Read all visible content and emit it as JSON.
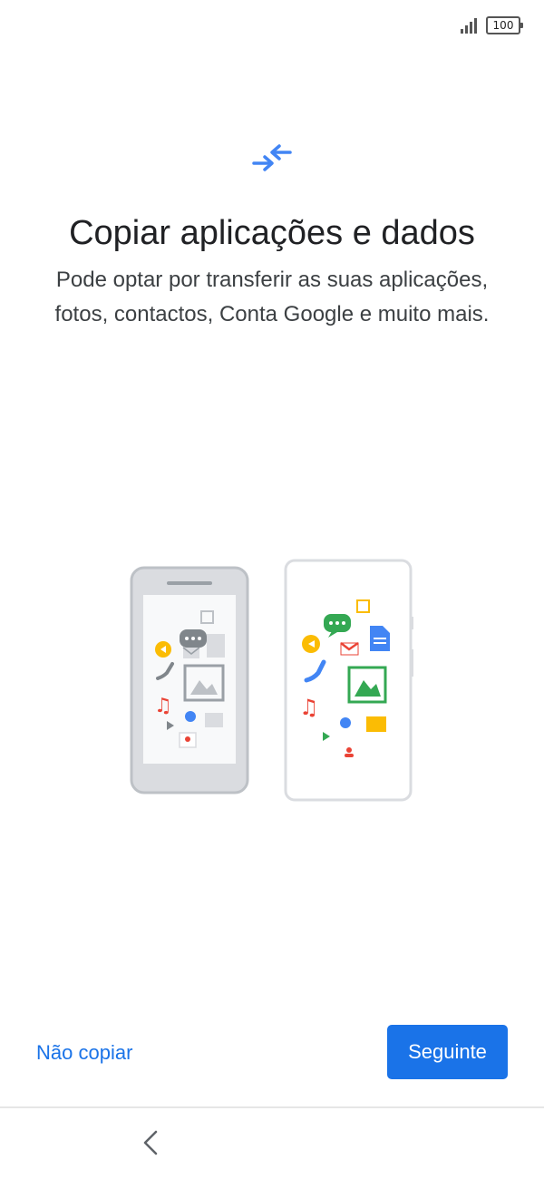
{
  "status_bar": {
    "battery_level": "100",
    "signal_bars": 4
  },
  "header": {
    "icon": "transfer-arrows-icon",
    "title": "Copiar aplicações e dados",
    "subtitle": "Pode optar por transferir as suas aplicações, fotos, contactos, Conta Google e muito mais."
  },
  "illustration": {
    "description_icons": [
      "old-phone-icon",
      "new-phone-icon"
    ]
  },
  "actions": {
    "skip_label": "Não copiar",
    "next_label": "Seguinte"
  },
  "navigation": {
    "back_icon": "chevron-left-icon"
  },
  "colors": {
    "accent": "#1a73e8",
    "title": "#202124",
    "body": "#3c4043"
  }
}
